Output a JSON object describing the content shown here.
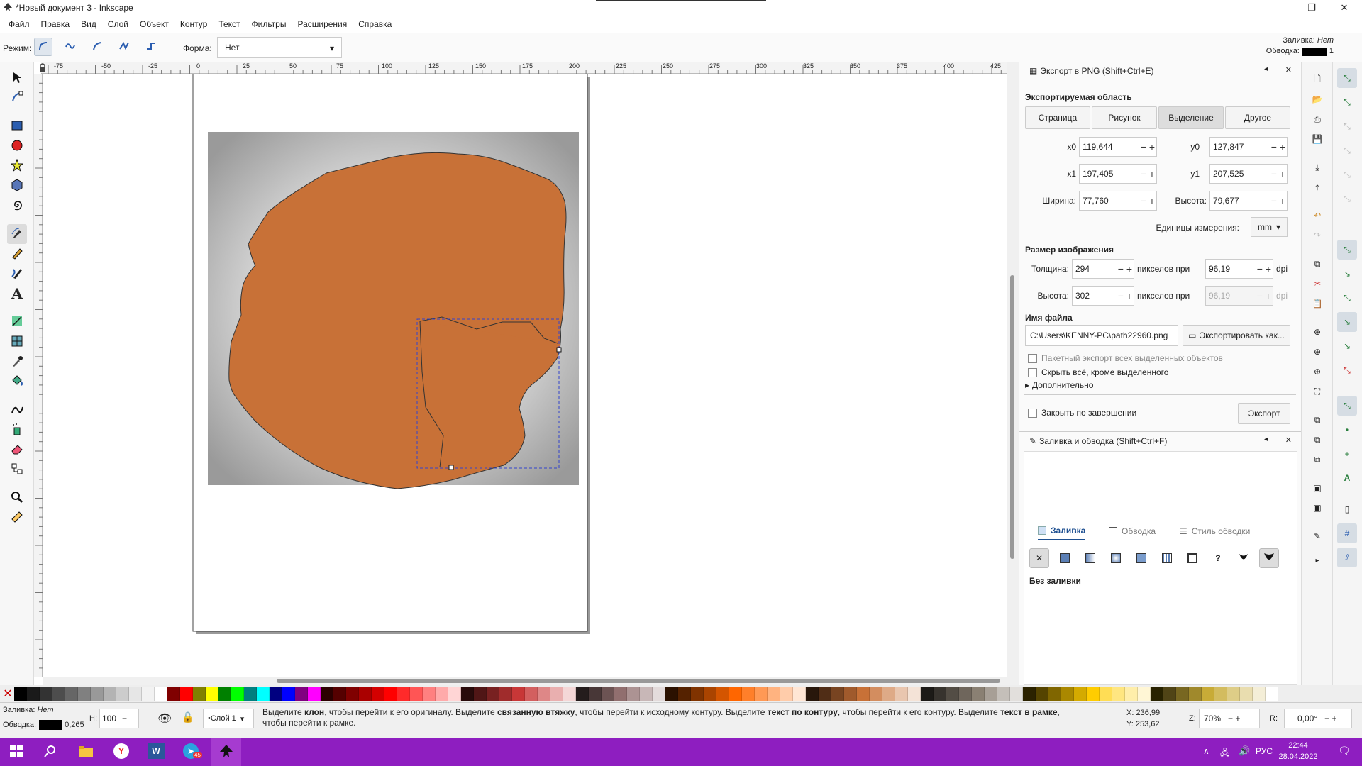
{
  "window": {
    "title": "*Новый документ 3 - Inkscape"
  },
  "menu": [
    "Файл",
    "Правка",
    "Вид",
    "Слой",
    "Объект",
    "Контур",
    "Текст",
    "Фильтры",
    "Расширения",
    "Справка"
  ],
  "tool_controls": {
    "mode_label": "Режим:",
    "shape_label": "Форма:",
    "shape_value": "Нет"
  },
  "fill_stroke_indicator": {
    "fill_label": "Заливка:",
    "fill_value": "Нет",
    "stroke_label": "Обводка:",
    "stroke_width": "1"
  },
  "ruler": {
    "ticks": [
      "-75",
      "-50",
      "-25",
      "0",
      "25",
      "50",
      "75",
      "100",
      "125",
      "150",
      "175",
      "200",
      "225",
      "250",
      "275",
      "300",
      "325",
      "350",
      "375",
      "400",
      "425"
    ]
  },
  "export_panel": {
    "title": "Экспорт в PNG (Shift+Ctrl+E)",
    "area_heading": "Экспортируемая область",
    "area_tabs": [
      "Страница",
      "Рисунок",
      "Выделение",
      "Другое"
    ],
    "x0_label": "x0",
    "x0": "119,644",
    "y0_label": "y0",
    "y0": "127,847",
    "x1_label": "x1",
    "x1": "197,405",
    "y1_label": "y1",
    "y1": "207,525",
    "width_label": "Ширина:",
    "width": "77,760",
    "height_label": "Высота:",
    "height": "79,677",
    "units_label": "Единицы измерения:",
    "units": "mm",
    "image_size_heading": "Размер изображения",
    "px_width_label": "Толщина:",
    "px_width": "294",
    "px_height_label": "Высота:",
    "px_height": "302",
    "pixels_at": "пикселов при",
    "dpi_x": "96,19",
    "dpi_y": "96,19",
    "dpi_label": "dpi",
    "filename_heading": "Имя файла",
    "filename": "C:\\Users\\KENNY-PC\\path22960.png",
    "export_as": "Экспортировать как...",
    "batch_export": "Пакетный экспорт всех выделенных объектов",
    "hide_all": "Скрыть всё, кроме выделенного",
    "advanced": "Дополнительно",
    "close_when_done": "Закрыть по завершении",
    "export_button": "Экспорт"
  },
  "fill_panel": {
    "title": "Заливка и обводка (Shift+Ctrl+F)",
    "tabs": [
      "Заливка",
      "Обводка",
      "Стиль обводки"
    ],
    "no_fill": "Без заливки"
  },
  "status": {
    "fill_label": "Заливка:",
    "fill_value": "Нет",
    "stroke_label": "Обводка:",
    "stroke_width": "0,265",
    "h_label": "Н:",
    "opacity": "100",
    "layer": "•Слой 1",
    "message_parts": [
      "Выделите ",
      "клон",
      ", чтобы перейти к его оригиналу. Выделите ",
      "связанную втяжку",
      ", чтобы перейти к исходному контуру. Выделите ",
      "текст по контуру",
      ", чтобы перейти к его контуру. Выделите ",
      "текст в рамке",
      ",",
      "чтобы перейти к рамке."
    ],
    "x_label": "X:",
    "x": "236,99",
    "y_label": "Y:",
    "y": "253,62",
    "zoom_label": "Z:",
    "zoom": "70%",
    "rotate_label": "R:",
    "rotate": "0,00°"
  },
  "palette": [
    "#000000",
    "#1a1a1a",
    "#333333",
    "#4d4d4d",
    "#666666",
    "#808080",
    "#999999",
    "#b3b3b3",
    "#cccccc",
    "#e6e6e6",
    "#f2f2f2",
    "#ffffff",
    "#800000",
    "#ff0000",
    "#808000",
    "#ffff00",
    "#008000",
    "#00ff00",
    "#008080",
    "#00ffff",
    "#000080",
    "#0000ff",
    "#800080",
    "#ff00ff",
    "#2b0000",
    "#550000",
    "#800000",
    "#aa0000",
    "#d40000",
    "#ff0000",
    "#ff2a2a",
    "#ff5555",
    "#ff8080",
    "#ffaaaa",
    "#ffd5d5",
    "#280b0b",
    "#501616",
    "#782121",
    "#a02c2c",
    "#c83737",
    "#d35f5f",
    "#de8787",
    "#e9afaf",
    "#f4d7d7",
    "#241c1c",
    "#483737",
    "#6c5353",
    "#916f6f",
    "#ac9393",
    "#c8b7b7",
    "#e3dbdb",
    "#2b1100",
    "#552200",
    "#803300",
    "#aa4400",
    "#d45500",
    "#ff6600",
    "#ff7f2a",
    "#ff9955",
    "#ffb380",
    "#ffccaa",
    "#ffe6d5",
    "#28170b",
    "#502d16",
    "#784421",
    "#a05a2c",
    "#c87137",
    "#d38d5f",
    "#deaa87",
    "#e9c6af",
    "#f4e3d7",
    "#1c1a17",
    "#37332e",
    "#534d45",
    "#6f665c",
    "#8a8073",
    "#a79f96",
    "#c4bfb9",
    "#e2dfdc",
    "#2b2200",
    "#554400",
    "#806600",
    "#aa8800",
    "#d4aa00",
    "#ffcc00",
    "#ffdd55",
    "#ffe680",
    "#ffeeaa",
    "#fff6d5",
    "#282200",
    "#504416",
    "#786721",
    "#a0892c",
    "#c8ab37",
    "#d3bc5f",
    "#decd87",
    "#e9ddaf",
    "#f4eed7",
    "#ffffff"
  ],
  "taskbar": {
    "lang": "РУС",
    "time": "22:44",
    "date": "28.04.2022",
    "telegram_badge": "45"
  },
  "colors": {
    "blob": "#c87137",
    "accent": "#8e1ec0",
    "snap": "#2a7f3e"
  }
}
